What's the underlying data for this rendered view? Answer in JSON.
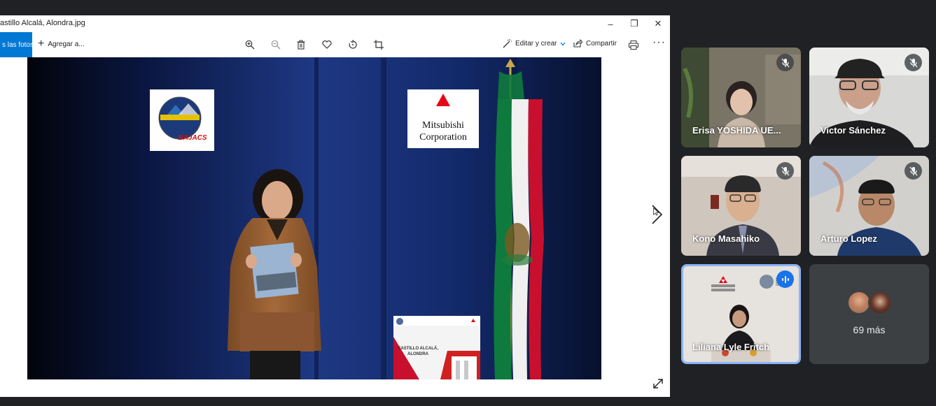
{
  "photos_app": {
    "title": "astillo Alcalá, Alondra.jpg",
    "window_controls": {
      "minimize": "–",
      "maximize": "❐",
      "close": "✕"
    },
    "toolbar": {
      "all_photos": "s las fotos",
      "add": "Agregar a...",
      "edit_create": "Editar y crear",
      "share": "Compartir"
    },
    "icons": [
      "zoom-in-icon",
      "zoom-out-icon",
      "trash-icon",
      "heart-icon",
      "rotate-icon",
      "crop-icon",
      "print-icon"
    ]
  },
  "photo": {
    "left_logo_text": "BAJACS",
    "right_logo": [
      "Mitsubishi",
      "Corporation"
    ],
    "certificate": {
      "name_line1": "CASTILLO ALCALÁ,",
      "name_line2": "ALONDRA"
    }
  },
  "meet": {
    "participants": [
      {
        "name": "Erisa YOSHIDA UE..."
      },
      {
        "name": "Victor Sánchez"
      },
      {
        "name": "Kono Masahiko"
      },
      {
        "name": "Arturo Lopez"
      },
      {
        "name": "Liliana Lyle Fritch"
      }
    ],
    "more_label": "69 más"
  },
  "colors": {
    "meet_bg": "#202124",
    "tile_bg": "#3c4043",
    "active_speaker": "#1a73e8",
    "photos_accent": "#0078d4"
  }
}
